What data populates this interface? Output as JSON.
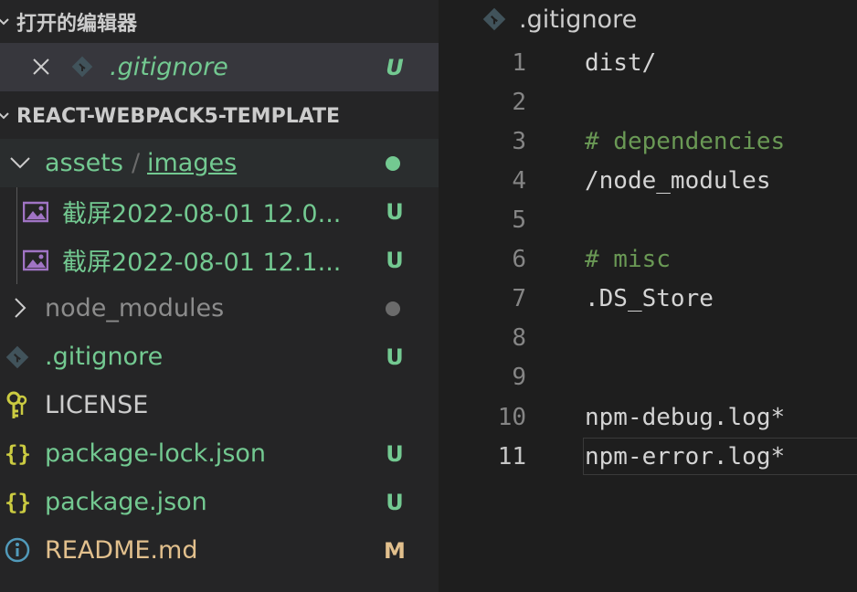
{
  "sidebar": {
    "open_editors": {
      "title": "打开的编辑器",
      "items": [
        {
          "name": ".gitignore",
          "badge": "U"
        }
      ]
    },
    "project": {
      "title": "REACT-WEBPACK5-TEMPLATE",
      "folder_path_part1": "assets",
      "folder_path_sep": "/",
      "folder_path_part2": "images",
      "files": [
        {
          "name": "截屏2022-08-01 12.0...",
          "badge": "U"
        },
        {
          "name": "截屏2022-08-01 12.1...",
          "badge": "U"
        }
      ],
      "node_modules": "node_modules",
      "root_files": [
        {
          "name": ".gitignore",
          "badge": "U"
        },
        {
          "name": "LICENSE",
          "badge": ""
        },
        {
          "name": "package-lock.json",
          "badge": "U"
        },
        {
          "name": "package.json",
          "badge": "U"
        },
        {
          "name": "README.md",
          "badge": "M"
        }
      ]
    }
  },
  "editor": {
    "tab_title": ".gitignore",
    "lines": [
      {
        "n": "1",
        "text": "dist/",
        "kind": "plain"
      },
      {
        "n": "2",
        "text": "",
        "kind": "plain"
      },
      {
        "n": "3",
        "text": "# dependencies",
        "kind": "comment"
      },
      {
        "n": "4",
        "text": "/node_modules",
        "kind": "plain"
      },
      {
        "n": "5",
        "text": "",
        "kind": "plain"
      },
      {
        "n": "6",
        "text": "# misc",
        "kind": "comment"
      },
      {
        "n": "7",
        "text": ".DS_Store",
        "kind": "plain"
      },
      {
        "n": "8",
        "text": "",
        "kind": "plain"
      },
      {
        "n": "9",
        "text": "",
        "kind": "plain"
      },
      {
        "n": "10",
        "text": "npm-debug.log*",
        "kind": "plain"
      },
      {
        "n": "11",
        "text": "npm-error.log*",
        "kind": "plain"
      }
    ]
  },
  "colors": {
    "untracked": "#73c991",
    "modified": "#e2c08d",
    "comment": "#6a9955"
  }
}
